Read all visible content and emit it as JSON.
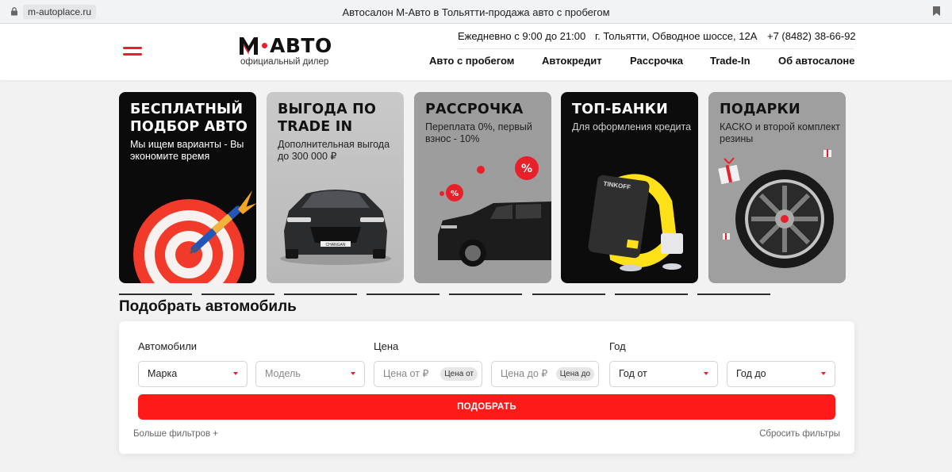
{
  "browser": {
    "url": "m-autoplace.ru",
    "title": "Автосалон М-Авто в Тольятти-продажа авто с пробегом"
  },
  "header": {
    "logo_text": "АВТО",
    "logo_letter": "М",
    "logo_subtitle": "официальный дилер",
    "hours": "Ежедневно с 9:00 до 21:00",
    "address": "г. Тольятти, Обводное шоссе, 12А",
    "phone": "+7 (8482) 38-66-92",
    "nav": [
      "Авто с пробегом",
      "Автокредит",
      "Рассрочка",
      "Trade-In",
      "Об автосалоне"
    ]
  },
  "promos": [
    {
      "title": "БЕСПЛАТНЫЙ ПОДБОР АВТО",
      "subtitle": "Мы ищем варианты - Вы экономите время",
      "image": "target-dart-icon"
    },
    {
      "title": "ВЫГОДА ПО TRADE IN",
      "subtitle": "Дополнительная выгода до 300 000 ₽",
      "image": "sedan-car"
    },
    {
      "title": "РАССРОЧКА",
      "subtitle": "Переплата 0%, первый взнос - 10%",
      "image": "suv-car"
    },
    {
      "title": "ТОП-БАНКИ",
      "subtitle": "Для оформления кредита",
      "image": "bank-card"
    },
    {
      "title": "ПОДАРКИ",
      "subtitle": "КАСКО и второй комплект резины",
      "image": "wheel-gift"
    }
  ],
  "promo_bank_card": {
    "brand": "TINKOFF"
  },
  "promo_sedan_plate": "CHANGAN",
  "carousel": {
    "count": 8,
    "active": 0
  },
  "search": {
    "title": "Подобрать автомобиль",
    "labels": {
      "cars": "Автомобили",
      "price": "Цена",
      "year": "Год"
    },
    "make": "Марка",
    "model": "Модель",
    "price_from_placeholder": "Цена от ₽",
    "price_from_chip": "Цена от",
    "price_to_placeholder": "Цена до ₽",
    "price_to_chip": "Цена до",
    "year_from": "Год от",
    "year_to": "Год до",
    "submit": "ПОДОБРАТЬ",
    "more_filters": "Больше фильтров +",
    "reset": "Сбросить фильтры"
  },
  "colors": {
    "accent": "#e8202a",
    "button": "#ff1a1a"
  }
}
